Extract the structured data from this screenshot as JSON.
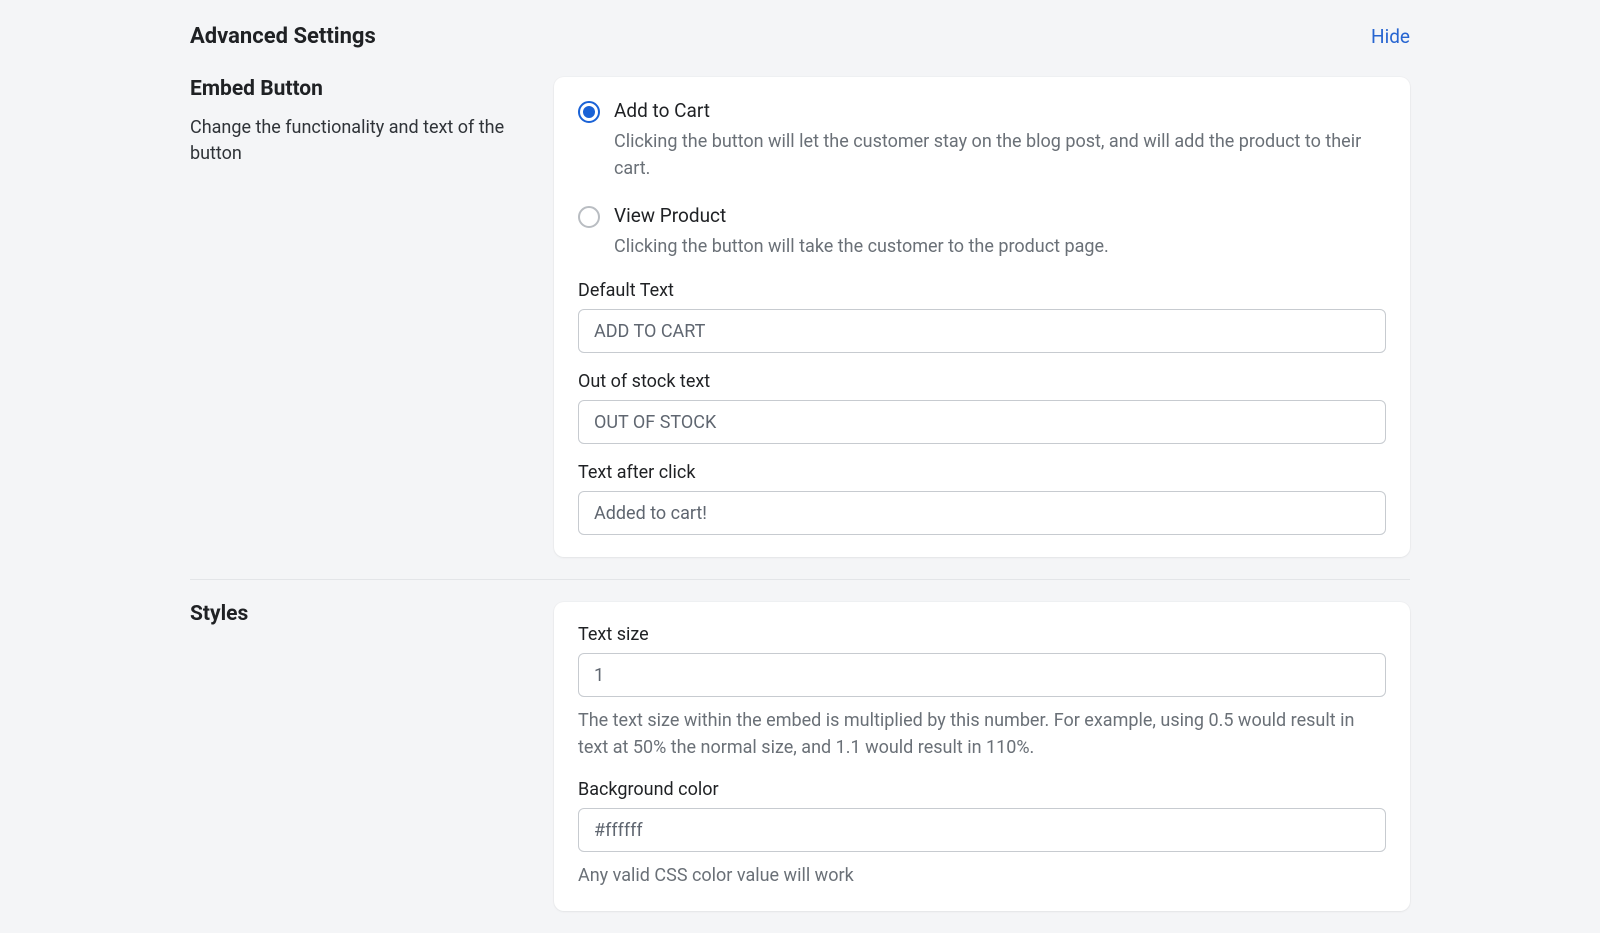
{
  "header": {
    "title": "Advanced Settings",
    "hide": "Hide"
  },
  "embed": {
    "title": "Embed Button",
    "sub": "Change the functionality and text of the button",
    "radios": [
      {
        "label": "Add to Cart",
        "desc": "Clicking the button will let the customer stay on the blog post, and will add the product to their cart.",
        "selected": true
      },
      {
        "label": "View Product",
        "desc": "Clicking the button will take the customer to the product page.",
        "selected": false
      }
    ],
    "defaultText": {
      "label": "Default Text",
      "value": "ADD TO CART"
    },
    "outOfStock": {
      "label": "Out of stock text",
      "value": "OUT OF STOCK"
    },
    "afterClick": {
      "label": "Text after click",
      "value": "Added to cart!"
    }
  },
  "styles": {
    "title": "Styles",
    "textSize": {
      "label": "Text size",
      "value": "1",
      "help": "The text size within the embed is multiplied by this number. For example, using 0.5 would result in text at 50% the normal size, and 1.1 would result in 110%."
    },
    "bgColor": {
      "label": "Background color",
      "value": "#ffffff",
      "help": "Any valid CSS color value will work"
    }
  }
}
